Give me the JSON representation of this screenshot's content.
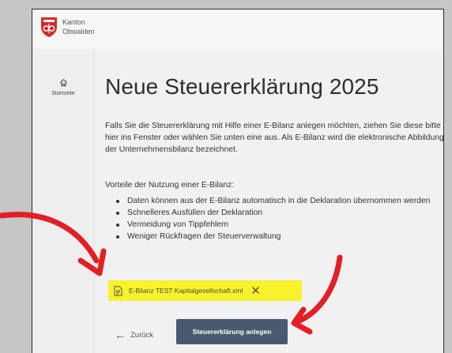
{
  "brand": {
    "line1": "Kanton",
    "line2": "Obwalden"
  },
  "sidebar": {
    "items": [
      {
        "label": "Startseite",
        "icon": "home-icon"
      }
    ]
  },
  "main": {
    "title": "Neue Steuererklärung 2025",
    "intro": "Falls Sie die Steuererklärung mit Hilfe einer E-Bilanz anlegen möchten, ziehen Sie diese bitte hier ins Fenster oder wählen Sie unten eine aus. Als E-Bilanz wird die elektronische Abbildung der Unternehmensbilanz bezeichnet.",
    "advantages_heading": "Vorteile der Nutzung einer E-Bilanz:",
    "advantages": [
      "Daten können aus der E-Bilanz automatisch in die Deklaration übernommen werden",
      "Schnelleres Ausfüllen der Deklaration",
      "Vermeidung von Tippfehlern",
      "Weniger Rückfragen der Steuerverwaltung"
    ],
    "file": {
      "name": "E-Bilanz TEST Kapitalgesellschaft.xml",
      "icon": "file-icon",
      "remove_icon": "close-icon"
    },
    "back_label": "Zurück",
    "create_label": "Steuererklärung anlegen"
  },
  "colors": {
    "highlight": "#f7f22a",
    "primary_button": "#4a5a6e",
    "annotation_arrow": "#e31e24",
    "background": "#c6c6c6"
  }
}
